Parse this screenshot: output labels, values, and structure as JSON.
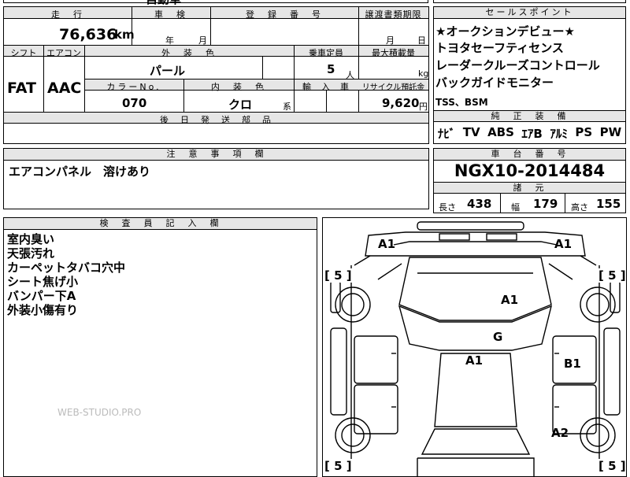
{
  "top_strip": "自動車",
  "main": {
    "h_mileage": "走　行",
    "h_inspection": "車　検",
    "h_reg": "登　録　番　号",
    "h_transfer": "譲渡書類期限",
    "mileage": "76,636",
    "mileage_unit": "km",
    "insp_year": "年",
    "insp_month": "月",
    "transfer_month": "月",
    "transfer_day": "日",
    "h_shift": "シフト",
    "h_ac": "エアコン",
    "h_exterior": "外　装　色",
    "h_capacity": "乗車定員",
    "h_maxload": "最大積載量",
    "shift": "FAT",
    "ac": "AAC",
    "exterior_color": "パール",
    "capacity": "5",
    "capacity_unit": "人",
    "maxload_unit": "kg",
    "h_colorno": "カラーNo.",
    "h_interior": "内　装　色",
    "h_import": "輸　入　車",
    "h_recycle": "リサイクル預託金",
    "color_no": "070",
    "interior_color": "クロ",
    "interior_suffix": "系",
    "recycle_fee": "9,620",
    "recycle_unit": "円",
    "h_later_parts": "後　日　発　送　部　品"
  },
  "sales": {
    "header": "セールスポイント",
    "points": [
      "★オークションデビュー★",
      "トヨタセーフティセンス",
      "レーダークルーズコントロール",
      "バックガイドモニター",
      "TSS、BSM"
    ],
    "equip_header": "純　正　装　備",
    "equipment": [
      "ﾅﾋﾞ",
      "TV",
      "ABS",
      "ｴｱB",
      "ｱﾙﾐ",
      "PS",
      "PW"
    ]
  },
  "notes": {
    "header": "注　意　事　項　欄",
    "text": "エアコンパネル　溶けあり"
  },
  "chassis": {
    "header": "車　台　番　号",
    "number": "NGX10-2014484",
    "spec_header": "諸　元",
    "len_label": "長さ",
    "len": "438",
    "wid_label": "幅",
    "wid": "179",
    "hgt_label": "高さ",
    "hgt": "155"
  },
  "inspector": {
    "header": "検　査　員　記　入　欄",
    "items": [
      "室内臭い",
      "天張汚れ",
      "カーペットタバコ穴中",
      "シート焦げ小",
      "バンパー下A",
      "外装小傷有り"
    ]
  },
  "watermark": "WEB-STUDIO.PRO",
  "diagram": {
    "marks": [
      "A1",
      "A1",
      "A1",
      "G",
      "A1",
      "B1",
      "A2"
    ],
    "tires": [
      "[ 5 ]",
      "[ 5 ]",
      "[ 5 ]",
      "[ 5 ]"
    ]
  }
}
